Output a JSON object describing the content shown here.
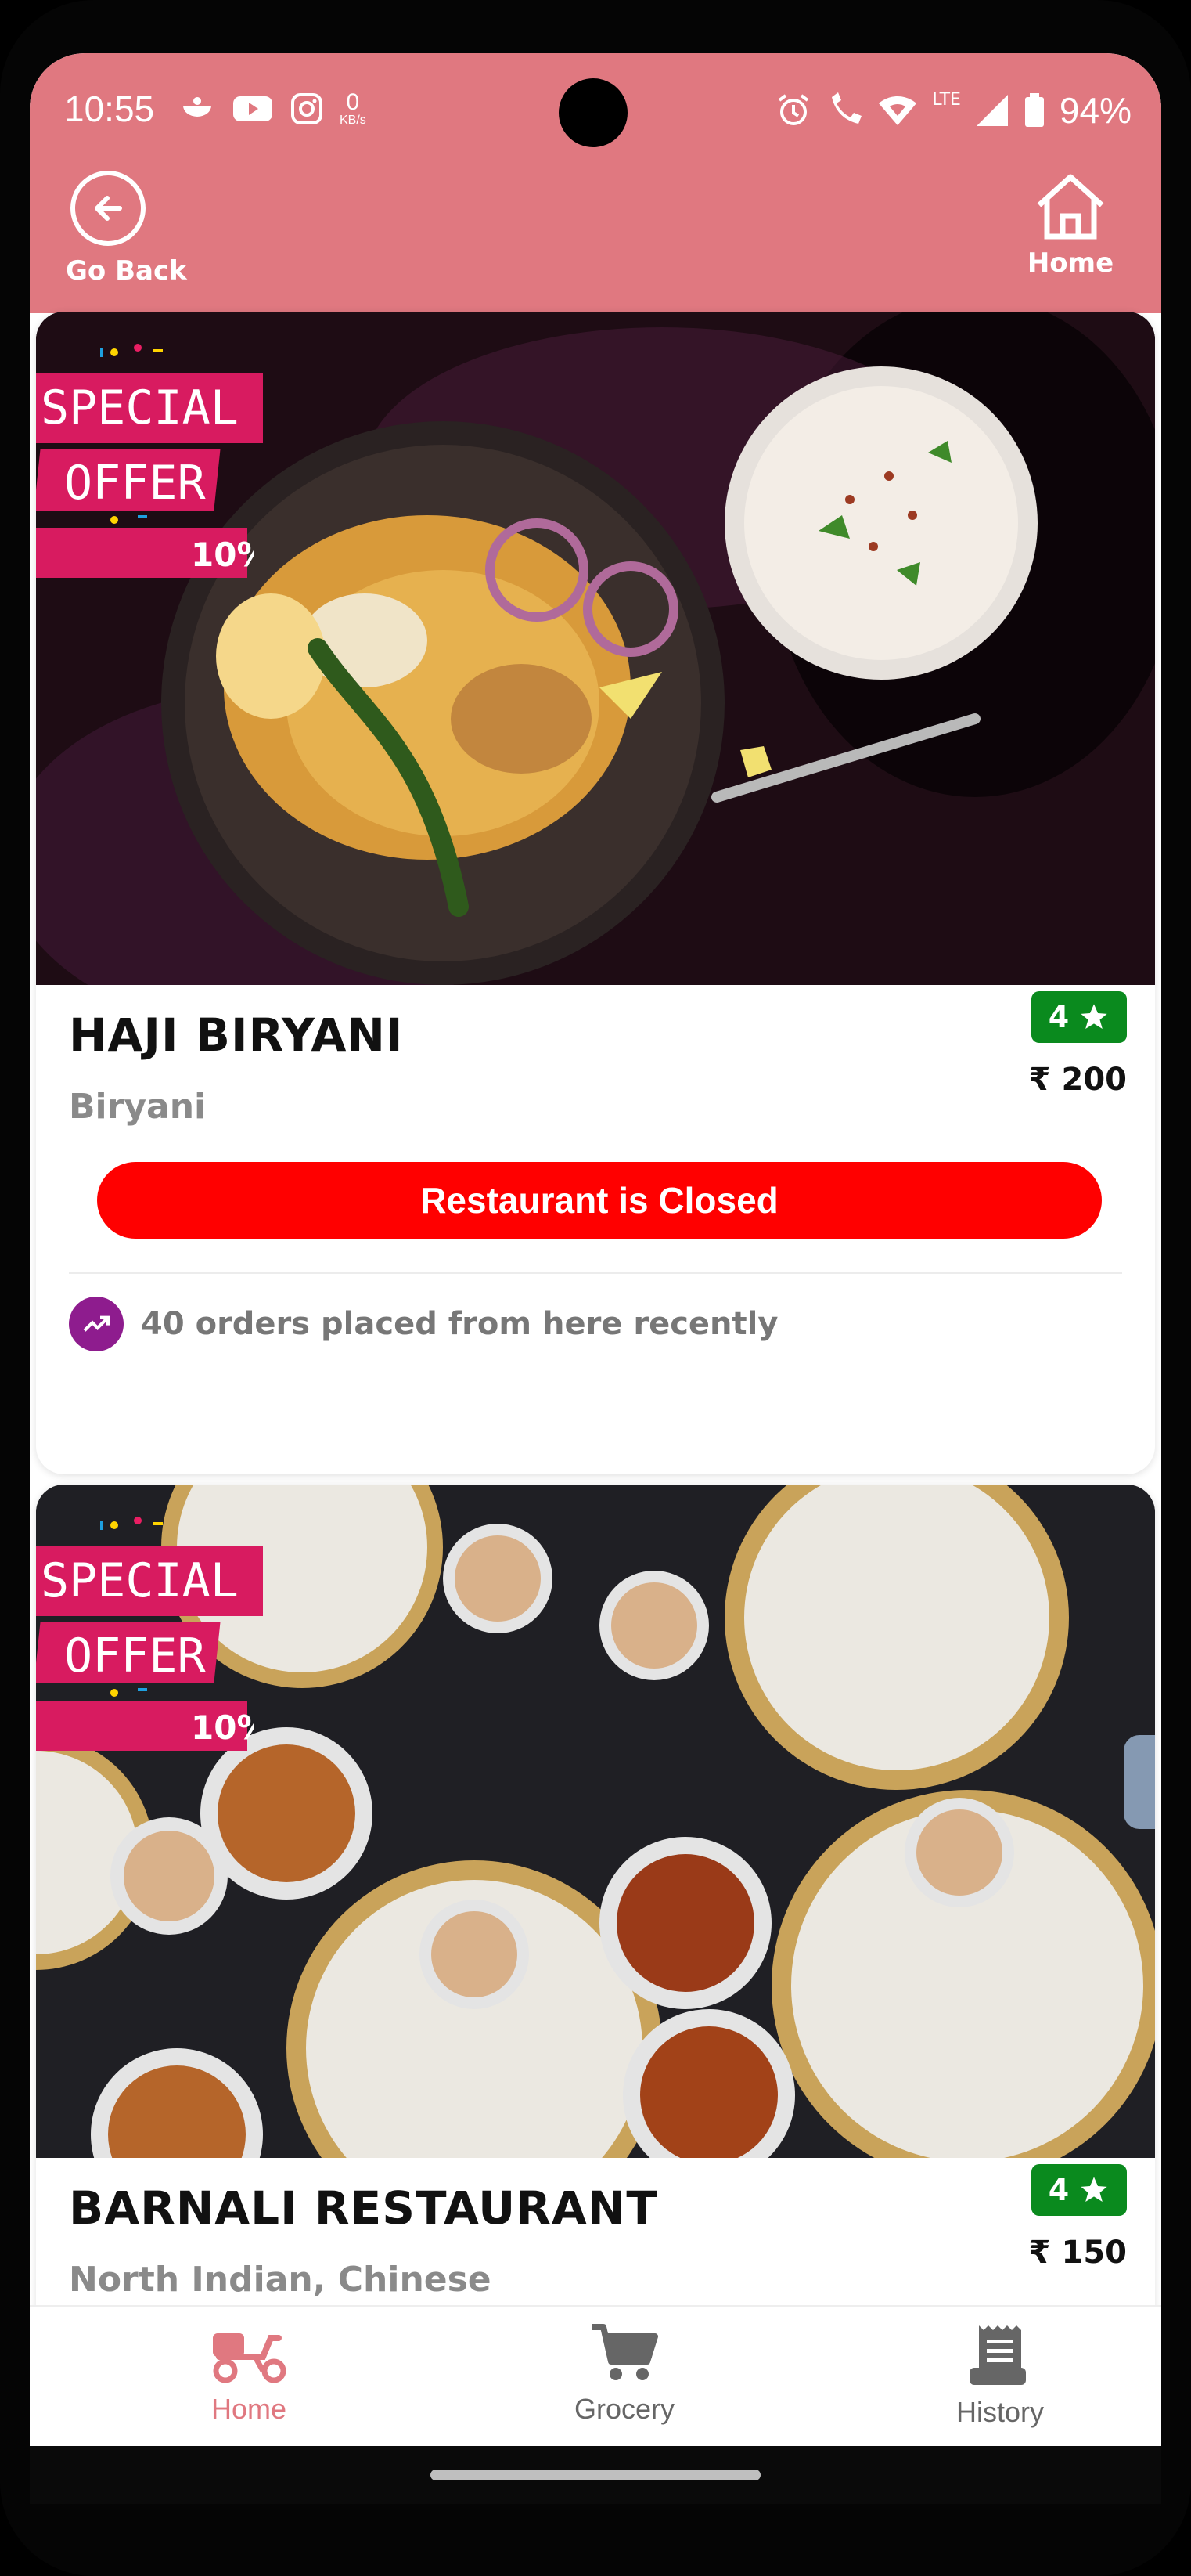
{
  "status_bar": {
    "time": "10:55",
    "net_speed_value": "0",
    "net_speed_unit": "KB/s",
    "network_label": "LTE",
    "battery": "94%"
  },
  "header": {
    "back_label": "Go Back",
    "home_label": "Home",
    "background": "#e07880"
  },
  "restaurants": [
    {
      "name": "HAJI BIRYANI",
      "cuisine": "Biryani",
      "rating": "4",
      "price": "₹ 200",
      "status_button": "Restaurant is Closed",
      "orders_text": "40 orders placed from here recently",
      "offer_line1": "SPECIAL",
      "offer_line2": "OFFER",
      "offer_percent": "10%"
    },
    {
      "name": "BARNALI RESTAURANT",
      "cuisine": "North Indian, Chinese",
      "rating": "4",
      "price": "₹ 150",
      "offer_line1": "SPECIAL",
      "offer_line2": "OFFER",
      "offer_percent": "10%"
    }
  ],
  "bottom_nav": {
    "items": [
      {
        "label": "Home",
        "icon": "scooter-icon",
        "active": true
      },
      {
        "label": "Grocery",
        "icon": "cart-icon",
        "active": false
      },
      {
        "label": "History",
        "icon": "receipt-icon",
        "active": false
      }
    ],
    "active_color": "#e07880",
    "inactive_color": "#666666"
  },
  "colors": {
    "closed_button": "#ff0000",
    "rating_badge": "#0a8a1e",
    "trend_icon_bg": "#8e1c8e",
    "offer_badge": "#d81b60"
  }
}
